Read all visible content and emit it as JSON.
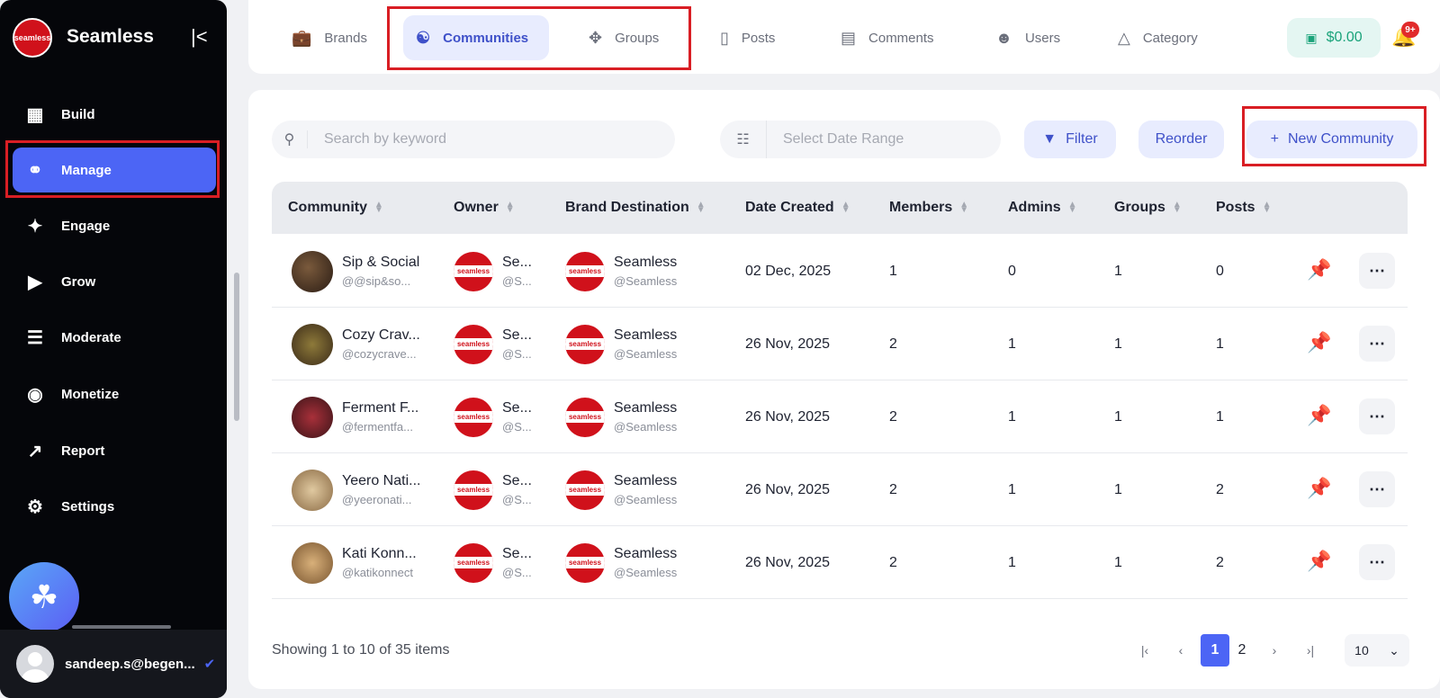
{
  "sidebar": {
    "brand": "Seamless",
    "logo_text": "seamless",
    "collapse_icon": "collapse-icon",
    "items": [
      {
        "label": "Build",
        "icon": "build-icon"
      },
      {
        "label": "Manage",
        "icon": "manage-icon",
        "active": true
      },
      {
        "label": "Engage",
        "icon": "engage-icon"
      },
      {
        "label": "Grow",
        "icon": "grow-icon"
      },
      {
        "label": "Moderate",
        "icon": "moderate-icon"
      },
      {
        "label": "Monetize",
        "icon": "monetize-icon"
      },
      {
        "label": "Report",
        "icon": "report-icon"
      },
      {
        "label": "Settings",
        "icon": "settings-icon"
      }
    ],
    "user": "sandeep.s@begen..."
  },
  "topnav": {
    "tabs": [
      {
        "label": "Brands",
        "icon": "briefcase-icon"
      },
      {
        "label": "Communities",
        "icon": "people-icon",
        "active": true
      },
      {
        "label": "Groups",
        "icon": "groups-icon"
      },
      {
        "label": "Posts",
        "icon": "posts-icon"
      },
      {
        "label": "Comments",
        "icon": "comment-icon"
      },
      {
        "label": "Users",
        "icon": "users-icon"
      },
      {
        "label": "Category",
        "icon": "category-icon"
      }
    ],
    "wallet": "$0.00",
    "notifications_badge": "9+"
  },
  "toolbar": {
    "search_placeholder": "Search by keyword",
    "date_placeholder": "Select Date Range",
    "filter_label": "Filter",
    "reorder_label": "Reorder",
    "new_label": "New Community"
  },
  "table": {
    "headers": [
      "Community",
      "Owner",
      "Brand Destination",
      "Date Created",
      "Members",
      "Admins",
      "Groups",
      "Posts"
    ],
    "rows": [
      {
        "name": "Sip & Social",
        "handle": "@@sip&so...",
        "owner": "Se...",
        "owner_handle": "@S...",
        "brand": "Seamless",
        "brand_handle": "@Seamless",
        "date": "02 Dec, 2025",
        "members": "1",
        "admins": "0",
        "groups": "1",
        "posts": "0"
      },
      {
        "name": "Cozy Crav...",
        "handle": "@cozycrave...",
        "owner": "Se...",
        "owner_handle": "@S...",
        "brand": "Seamless",
        "brand_handle": "@Seamless",
        "date": "26 Nov, 2025",
        "members": "2",
        "admins": "1",
        "groups": "1",
        "posts": "1"
      },
      {
        "name": "Ferment F...",
        "handle": "@fermentfa...",
        "owner": "Se...",
        "owner_handle": "@S...",
        "brand": "Seamless",
        "brand_handle": "@Seamless",
        "date": "26 Nov, 2025",
        "members": "2",
        "admins": "1",
        "groups": "1",
        "posts": "1"
      },
      {
        "name": "Yeero Nati...",
        "handle": "@yeeronati...",
        "owner": "Se...",
        "owner_handle": "@S...",
        "brand": "Seamless",
        "brand_handle": "@Seamless",
        "date": "26 Nov, 2025",
        "members": "2",
        "admins": "1",
        "groups": "1",
        "posts": "2"
      },
      {
        "name": "Kati Konn...",
        "handle": "@katikonnect",
        "owner": "Se...",
        "owner_handle": "@S...",
        "brand": "Seamless",
        "brand_handle": "@Seamless",
        "date": "26 Nov, 2025",
        "members": "2",
        "admins": "1",
        "groups": "1",
        "posts": "2"
      }
    ]
  },
  "footer": {
    "showing": "Showing 1 to 10 of 35 items",
    "pages": [
      "1",
      "2"
    ],
    "page_size": "10"
  },
  "colors": {
    "accent": "#4c65f5",
    "brand_red": "#d0111b",
    "highlight_box": "#d91e24"
  }
}
